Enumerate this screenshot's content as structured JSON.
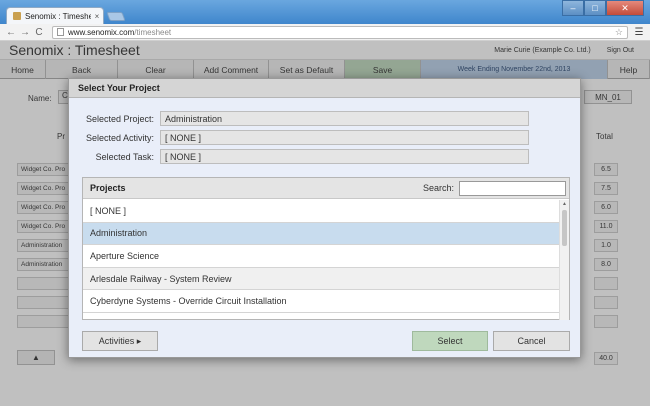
{
  "browser": {
    "tab_title": "Senomix : Timesheet",
    "tab_close": "×",
    "url_host": "www.senomix.com",
    "url_path": "/timesheet",
    "nav": {
      "back": "←",
      "forward": "→",
      "reload": "C"
    },
    "star": "☆",
    "menu": "☰",
    "window": {
      "minimize": "–",
      "maximize": "□",
      "close": "✕"
    }
  },
  "app": {
    "title": "Senomix : Timesheet",
    "user": "Marie Curie  (Example Co. Ltd.)",
    "signout": "Sign Out"
  },
  "menubar": {
    "items": [
      {
        "label": "Home"
      },
      {
        "label": "Back"
      },
      {
        "label": "Clear"
      },
      {
        "label": "Add Comment"
      },
      {
        "label": "Set as Default"
      },
      {
        "label": "Save"
      },
      {
        "label": "Week Ending November 22nd, 2013"
      },
      {
        "label": "Help"
      }
    ]
  },
  "background": {
    "name_label": "Name:",
    "name_initial": "C",
    "code": "MN_01",
    "project_col": "Pr",
    "total_col": "Total",
    "rows": [
      {
        "label": "Widget Co. Pro",
        "total": "6.5"
      },
      {
        "label": "Widget Co. Pro",
        "total": "7.5"
      },
      {
        "label": "Widget Co. Pro",
        "total": "6.0"
      },
      {
        "label": "Widget Co. Pro",
        "total": "11.0"
      },
      {
        "label": "Administration",
        "total": "1.0"
      },
      {
        "label": "Administration",
        "total": "8.0"
      }
    ],
    "grand_total": "40.0",
    "up_arrow": "▲"
  },
  "modal": {
    "title": "Select Your Project",
    "fields": [
      {
        "label": "Selected Project:",
        "value": "Administration"
      },
      {
        "label": "Selected Activity:",
        "value": "[ NONE ]"
      },
      {
        "label": "Selected Task:",
        "value": "[ NONE ]"
      }
    ],
    "projects_header": "Projects",
    "search_label": "Search:",
    "search_value": "",
    "projects": [
      {
        "label": "[ NONE ]"
      },
      {
        "label": "Administration"
      },
      {
        "label": "Aperture Science"
      },
      {
        "label": "Arlesdale Railway - System Review"
      },
      {
        "label": "Cyberdyne Systems - Override Circuit Installation"
      }
    ],
    "buttons": {
      "activities": "Activities ▸",
      "select": "Select",
      "cancel": "Cancel"
    }
  }
}
